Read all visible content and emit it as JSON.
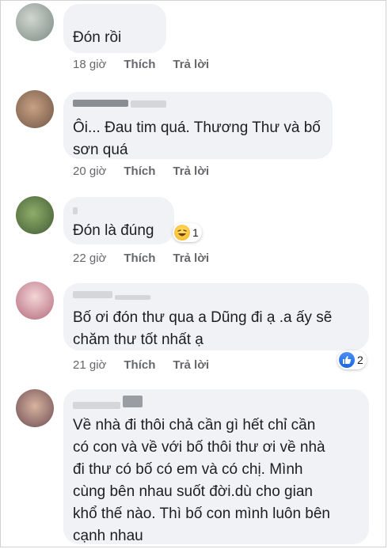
{
  "comments": [
    {
      "text": "Đón rồi",
      "time": "18 giờ",
      "like_label": "Thích",
      "reply_label": "Trả lời"
    },
    {
      "text": "Ôi... Đau tim quá. Thương Thư và bố\nsơn quá",
      "time": "20 giờ",
      "like_label": "Thích",
      "reply_label": "Trả lời"
    },
    {
      "text": "Đón là đúng",
      "time": "22 giờ",
      "like_label": "Thích",
      "reply_label": "Trả lời",
      "reaction": {
        "icon": "haha-icon",
        "count": "1"
      }
    },
    {
      "text": "Bố ơi đón thư qua a Dũng đi ạ .a ấy sẽ\nchăm thư tốt nhất ạ",
      "time": "21 giờ",
      "like_label": "Thích",
      "reply_label": "Trả lời",
      "reaction": {
        "icon": "like-icon",
        "count": "2"
      }
    },
    {
      "text": "Về nhà đi thôi chả cần gì hết chỉ cần\ncó con và về với bố thôi thư ơi về nhà\nđi thư có bố có em và có chị. Mình\ncùng bên nhau suốt đời.dù cho gian\nkhổ thế nào. Thì bố con mình luôn bên\ncạnh nhau"
    }
  ],
  "colors": {
    "bubble": "#f0f2f5",
    "meta": "#65676b",
    "text": "#1c1e21",
    "like_blue": "#1c64e0"
  }
}
